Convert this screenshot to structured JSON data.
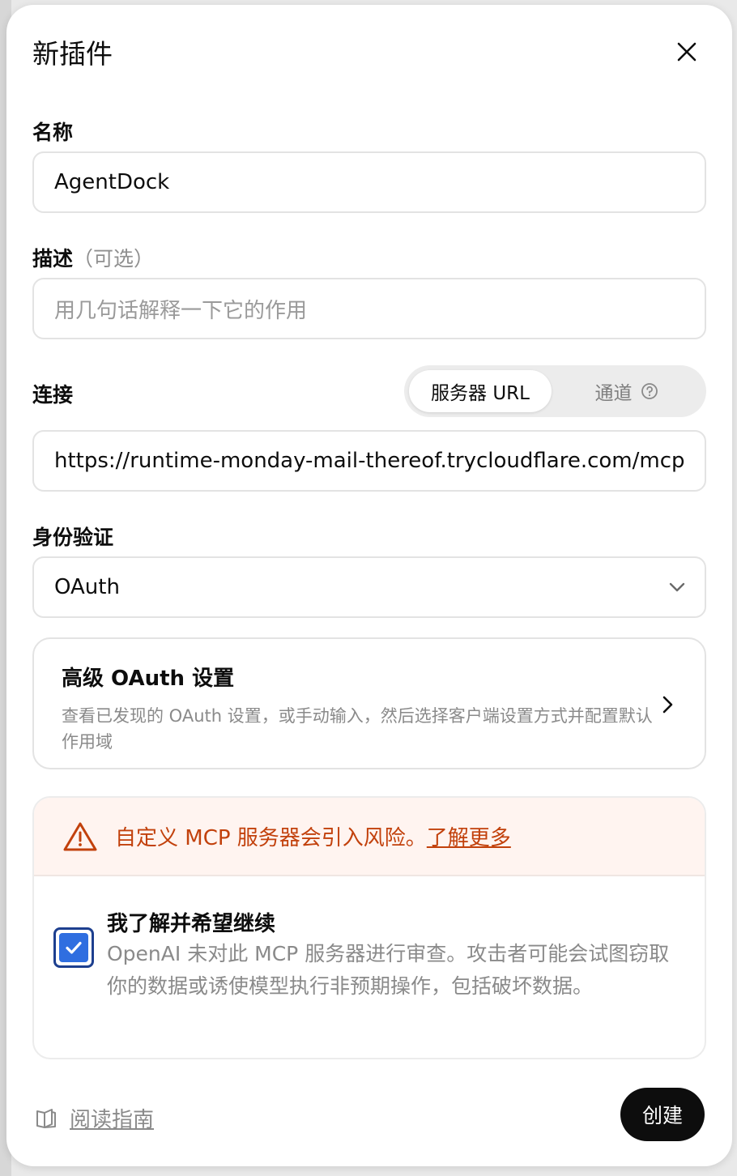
{
  "dialog": {
    "title": "新插件",
    "close_icon": "close-icon"
  },
  "name": {
    "label": "名称",
    "value": "AgentDock"
  },
  "description": {
    "label": "描述",
    "optional": "（可选）",
    "placeholder": "用几句话解释一下它的作用"
  },
  "connection": {
    "label": "连接",
    "toggle": {
      "options": [
        "服务器 URL",
        "通道"
      ],
      "selected": "服务器 URL",
      "help_icon": "help-circle-icon"
    },
    "url": "https://runtime-monday-mail-thereof.trycloudflare.com/mcp"
  },
  "auth": {
    "label": "身份验证",
    "selected": "OAuth",
    "chevron_icon": "chevron-down-icon"
  },
  "advanced_oauth": {
    "title": "高级 OAuth 设置",
    "description": "查看已发现的 OAuth 设置，或手动输入，然后选择客户端设置方式并配置默认作用域",
    "chevron_icon": "chevron-right-icon"
  },
  "warning": {
    "text": "自定义 MCP 服务器会引入风险。",
    "link": "了解更多",
    "icon": "warning-triangle-icon",
    "color": "#c2410c",
    "background": "#fff4f0"
  },
  "consent": {
    "checked": true,
    "title": "我了解并希望继续",
    "description": "OpenAI 未对此 MCP 服务器进行审查。攻击者可能会试图窃取你的数据或诱使模型执行非预期操作，包括破坏数据。",
    "checkbox_color": "#2f6ee0"
  },
  "footer": {
    "guide_label": "阅读指南",
    "guide_icon": "book-icon",
    "create_label": "创建"
  }
}
